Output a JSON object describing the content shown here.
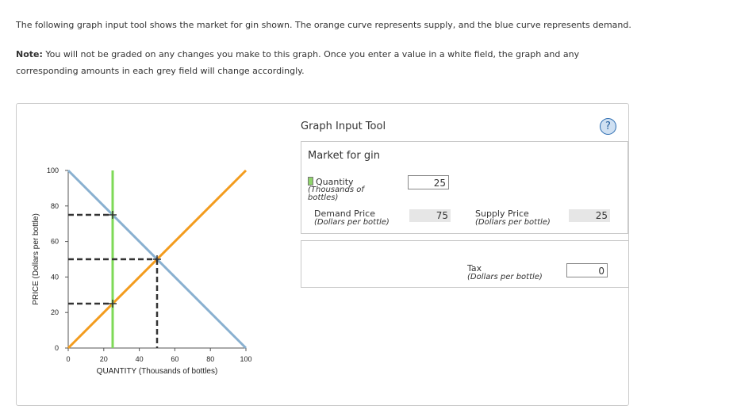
{
  "intro": "The following graph input tool shows the market for gin shown. The orange curve represents supply, and the blue curve represents demand.",
  "note": {
    "label": "Note:",
    "text": "You will not be graded on any changes you make to this graph. Once you enter a value in a white field, the graph and any corresponding amounts in each grey field will change accordingly."
  },
  "graph_input_tool": {
    "title": "Graph Input Tool",
    "help_icon": "question-mark-icon",
    "help_symbol": "?",
    "market_title": "Market for gin",
    "quantity": {
      "label": "Quantity",
      "unit": "(Thousands of bottles)",
      "value": "25"
    },
    "demand_price": {
      "label": "Demand Price",
      "unit": "(Dollars per bottle)",
      "value": "75"
    },
    "supply_price": {
      "label": "Supply Price",
      "unit": "(Dollars per bottle)",
      "value": "25"
    },
    "tax": {
      "label": "Tax",
      "unit": "(Dollars per bottle)",
      "value": "0"
    }
  },
  "chart_data": {
    "type": "line",
    "xlabel": "QUANTITY (Thousands of bottles)",
    "ylabel": "PRICE (Dollars per bottle)",
    "xlim": [
      0,
      100
    ],
    "ylim": [
      0,
      100
    ],
    "x_ticks": [
      0,
      20,
      40,
      60,
      80,
      100
    ],
    "y_ticks": [
      0,
      20,
      40,
      60,
      80,
      100
    ],
    "grid": false,
    "series": [
      {
        "color": "#f39c1e",
        "x": [
          0,
          100
        ],
        "y": [
          0,
          100
        ]
      },
      {
        "color": "#89b0d0",
        "x": [
          0,
          100
        ],
        "y": [
          100,
          0
        ]
      }
    ],
    "quantity_line": {
      "x": 25,
      "color": "#7ed957"
    },
    "dashed_guides": [
      {
        "x": 25,
        "y": 75
      },
      {
        "x": 50,
        "y": 50
      },
      {
        "x": 25,
        "y": 25
      }
    ],
    "guide_color": "#333333"
  }
}
